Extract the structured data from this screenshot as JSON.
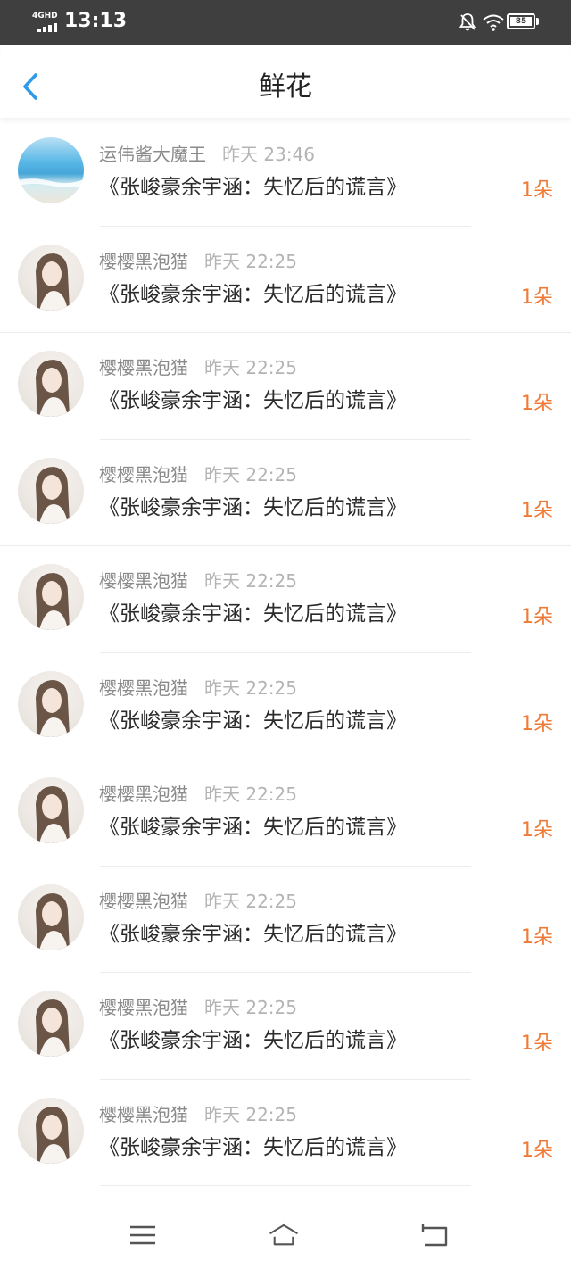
{
  "status_bar": {
    "network": "4GHD",
    "time": "13:13",
    "battery": "85",
    "icons": [
      "signal-icon",
      "mute-bell-icon",
      "wifi-icon",
      "battery-icon"
    ]
  },
  "header": {
    "back_icon": "chevron-left-icon",
    "title": "鲜花"
  },
  "rows": [
    {
      "user": "运伟酱大魔王",
      "time": "昨天 23:46",
      "book": "《张峻豪余宇涵：失忆后的谎言》",
      "count": "1朵"
    },
    {
      "user": "樱樱黑泡猫",
      "time": "昨天 22:25",
      "book": "《张峻豪余宇涵：失忆后的谎言》",
      "count": "1朵"
    },
    {
      "user": "樱樱黑泡猫",
      "time": "昨天 22:25",
      "book": "《张峻豪余宇涵：失忆后的谎言》",
      "count": "1朵"
    },
    {
      "user": "樱樱黑泡猫",
      "time": "昨天 22:25",
      "book": "《张峻豪余宇涵：失忆后的谎言》",
      "count": "1朵"
    },
    {
      "user": "樱樱黑泡猫",
      "time": "昨天 22:25",
      "book": "《张峻豪余宇涵：失忆后的谎言》",
      "count": "1朵"
    },
    {
      "user": "樱樱黑泡猫",
      "time": "昨天 22:25",
      "book": "《张峻豪余宇涵：失忆后的谎言》",
      "count": "1朵"
    },
    {
      "user": "樱樱黑泡猫",
      "time": "昨天 22:25",
      "book": "《张峻豪余宇涵：失忆后的谎言》",
      "count": "1朵"
    },
    {
      "user": "樱樱黑泡猫",
      "time": "昨天 22:25",
      "book": "《张峻豪余宇涵：失忆后的谎言》",
      "count": "1朵"
    },
    {
      "user": "樱樱黑泡猫",
      "time": "昨天 22:25",
      "book": "《张峻豪余宇涵：失忆后的谎言》",
      "count": "1朵"
    },
    {
      "user": "樱樱黑泡猫",
      "time": "昨天 22:25",
      "book": "《张峻豪余宇涵：失忆后的谎言》",
      "count": "1朵"
    }
  ],
  "bottom_nav": {
    "icons": [
      "menu-icon",
      "home-icon",
      "back-icon"
    ]
  },
  "colors": {
    "status_bar_bg": "#3f3f3f",
    "accent_blue": "#2f9ae8",
    "count_orange": "#ef7a36",
    "username_gray": "#8a8a8a",
    "time_gray": "#b4b4b4"
  }
}
